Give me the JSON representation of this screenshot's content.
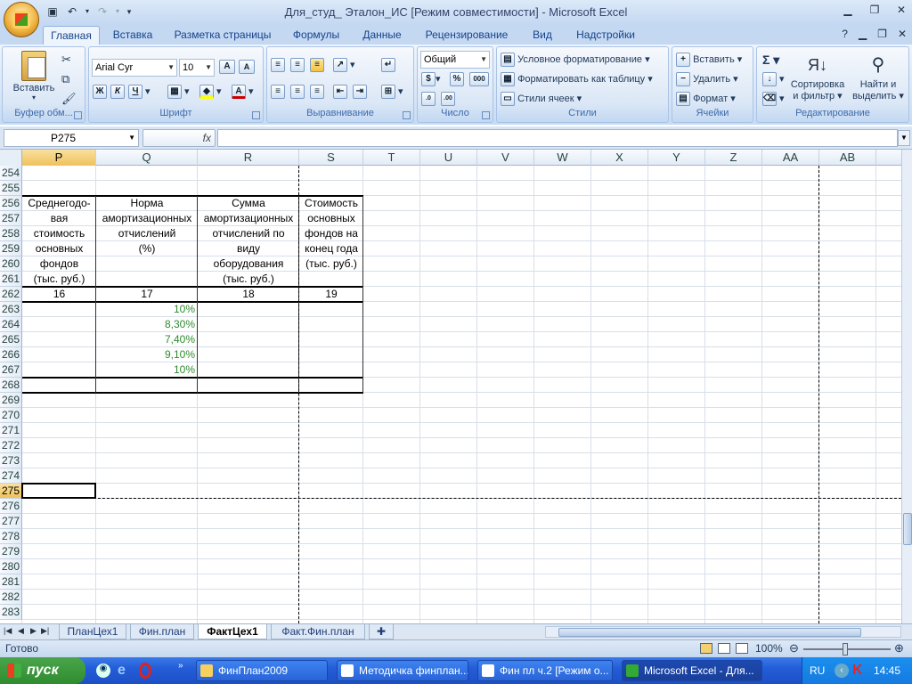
{
  "window": {
    "title": "Для_студ_ Эталон_ИС  [Режим совместимости] - Microsoft Excel"
  },
  "ribbon_tabs": [
    "Главная",
    "Вставка",
    "Разметка страницы",
    "Формулы",
    "Данные",
    "Рецензирование",
    "Вид",
    "Надстройки"
  ],
  "ribbon": {
    "clipboard": {
      "label": "Буфер обм...",
      "paste": "Вставить"
    },
    "font": {
      "label": "Шрифт",
      "name": "Arial Cyr",
      "size": "10",
      "bold": "Ж",
      "italic": "К",
      "underline": "Ч"
    },
    "alignment": {
      "label": "Выравнивание"
    },
    "number": {
      "label": "Число",
      "format": "Общий"
    },
    "styles": {
      "label": "Стили",
      "cond": "Условное форматирование",
      "table": "Форматировать как таблицу",
      "cell": "Стили ячеек"
    },
    "cells": {
      "label": "Ячейки",
      "insert": "Вставить",
      "delete": "Удалить",
      "format": "Формат"
    },
    "editing": {
      "label": "Редактирование",
      "sort": "Сортировка и фильтр",
      "find": "Найти и выделить"
    }
  },
  "formula_bar": {
    "name_box": "P275",
    "fx": "fx",
    "value": ""
  },
  "columns": [
    "P",
    "Q",
    "R",
    "S",
    "T",
    "U",
    "V",
    "W",
    "X",
    "Y",
    "Z",
    "AA",
    "AB"
  ],
  "rows": [
    "254",
    "255",
    "256",
    "257",
    "258",
    "259",
    "260",
    "261",
    "262",
    "263",
    "264",
    "265",
    "266",
    "267",
    "268",
    "269",
    "270",
    "271",
    "272",
    "273",
    "274",
    "275",
    "276",
    "277",
    "278",
    "279",
    "280",
    "281",
    "282",
    "283"
  ],
  "table": {
    "header_P": [
      "Среднегодо-",
      "вая",
      "стоимость",
      "основных",
      "фондов",
      "(тыс. руб.)"
    ],
    "header_Q": [
      "Норма",
      "амортизационных",
      "отчислений",
      "(%)"
    ],
    "header_R": [
      "Сумма",
      "амортизационных",
      "отчислений по",
      "виду",
      "оборудования",
      "(тыс. руб.)"
    ],
    "header_S": [
      "Стоимость",
      "основных",
      "фондов на",
      "конец года",
      "(тыс. руб.)"
    ],
    "col_numbers": [
      "16",
      "17",
      "18",
      "19"
    ],
    "q_values": [
      "10%",
      "8,30%",
      "7,40%",
      "9,10%",
      "10%"
    ]
  },
  "sheet_tabs": [
    "ПланЦех1",
    "Фин.план",
    "ФактЦех1",
    "Факт.Фин.план"
  ],
  "status": {
    "ready": "Готово",
    "zoom": "100%"
  },
  "taskbar": {
    "start": "пуск",
    "items": [
      "ФинПлан2009",
      "Методичка финплан...",
      "Фин пл ч.2 [Режим о...",
      "Microsoft Excel - Для..."
    ],
    "lang": "RU",
    "time": "14:45"
  }
}
